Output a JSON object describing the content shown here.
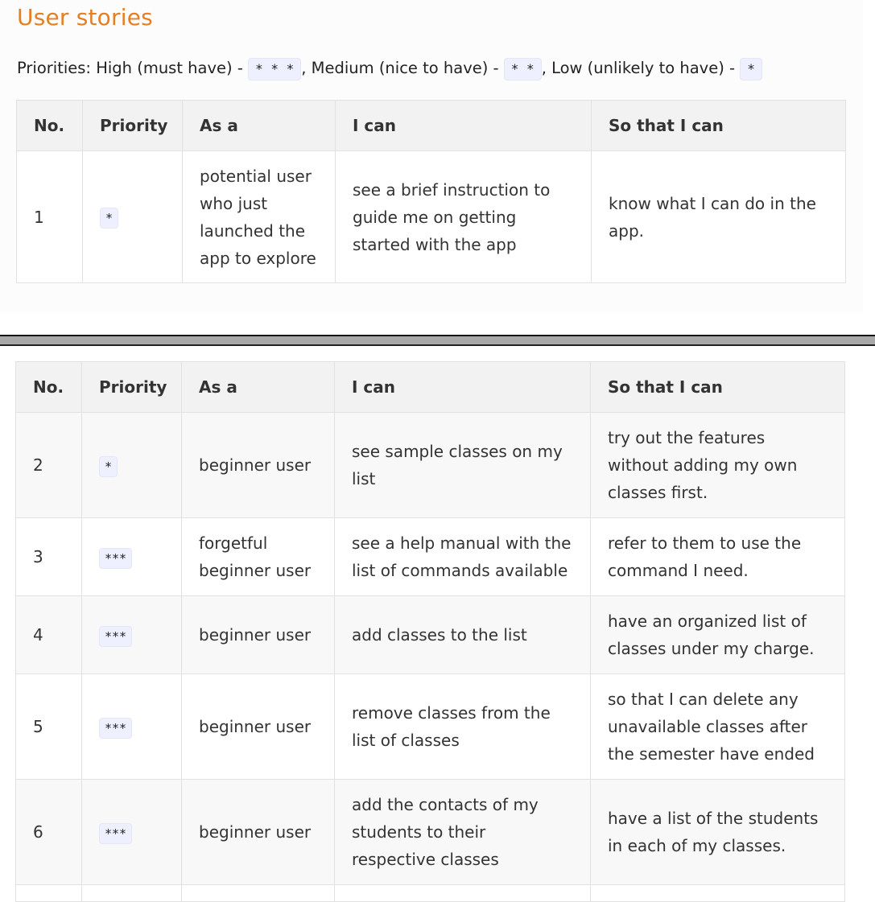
{
  "title": "User stories",
  "priorities": {
    "prefix": "Priorities: High (must have) - ",
    "high": "* * *",
    "mid_text": ", Medium (nice to have) - ",
    "medium": "* *",
    "low_text": ", Low (unlikely to have) - ",
    "low": "*"
  },
  "headers": [
    "No.",
    "Priority",
    "As a",
    "I can",
    "So that I can"
  ],
  "table_top_rows": [
    {
      "no": "1",
      "priority": "*",
      "as_a": "potential user who just launched the app to explore",
      "i_can": "see a brief instruction to guide me on getting started with the app",
      "so_that": "know what I can do in the app."
    }
  ],
  "table_bottom_rows": [
    {
      "no": "2",
      "priority": "*",
      "as_a": "beginner user",
      "i_can": "see sample classes on my list",
      "so_that": "try out the features without adding my own classes first."
    },
    {
      "no": "3",
      "priority": "***",
      "as_a": "forgetful beginner user",
      "i_can": "see a help manual with the list of commands available",
      "so_that": "refer to them to use the command I need."
    },
    {
      "no": "4",
      "priority": "***",
      "as_a": "beginner user",
      "i_can": "add classes to the list",
      "so_that": "have an organized list of classes under my charge."
    },
    {
      "no": "5",
      "priority": "***",
      "as_a": "beginner user",
      "i_can": "remove classes from the list of classes",
      "so_that": "so that I can delete any unavailable classes after the semester have ended"
    },
    {
      "no": "6",
      "priority": "***",
      "as_a": "beginner user",
      "i_can": "add the contacts of my students to their respective classes",
      "so_that": "have a list of the students in each of my classes."
    }
  ],
  "colors": {
    "title": "#e67e22",
    "code_bg": "#eef0ff",
    "header_bg": "#f2f2f2"
  }
}
